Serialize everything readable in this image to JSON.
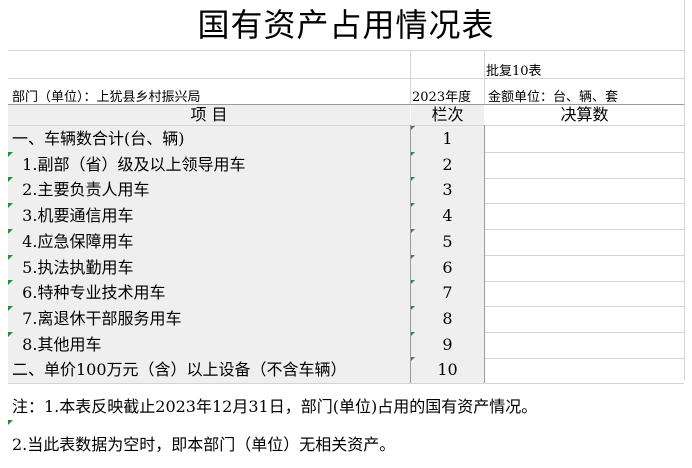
{
  "title": "国有资产占用情况表",
  "approval_note": "批复10表",
  "department": "部门（单位）：上犹县乡村振兴局",
  "year": "2023年度",
  "unit": "金额单位：台、辆、套",
  "headers": {
    "item": "项    目",
    "row_no": "栏次",
    "final": "决算数"
  },
  "rows": [
    {
      "label": "一、车辆数合计(台、辆)",
      "no": "1",
      "value": ""
    },
    {
      "label": "  1.副部（省）级及以上领导用车",
      "no": "2",
      "value": ""
    },
    {
      "label": "  2.主要负责人用车",
      "no": "3",
      "value": ""
    },
    {
      "label": "  3.机要通信用车",
      "no": "4",
      "value": ""
    },
    {
      "label": "  4.应急保障用车",
      "no": "5",
      "value": ""
    },
    {
      "label": "  5.执法执勤用车",
      "no": "6",
      "value": ""
    },
    {
      "label": "  6.特种专业技术用车",
      "no": "7",
      "value": ""
    },
    {
      "label": "  7.离退休干部服务用车",
      "no": "8",
      "value": ""
    },
    {
      "label": "  8.其他用车",
      "no": "9",
      "value": ""
    },
    {
      "label": "二、单价100万元（含）以上设备（不含车辆）",
      "no": "10",
      "value": ""
    }
  ],
  "notes": [
    "注：1.本表反映截止2023年12月31日，部门(单位)占用的国有资产情况。",
    "    2.当此表数据为空时，即本部门（单位）无相关资产。"
  ]
}
